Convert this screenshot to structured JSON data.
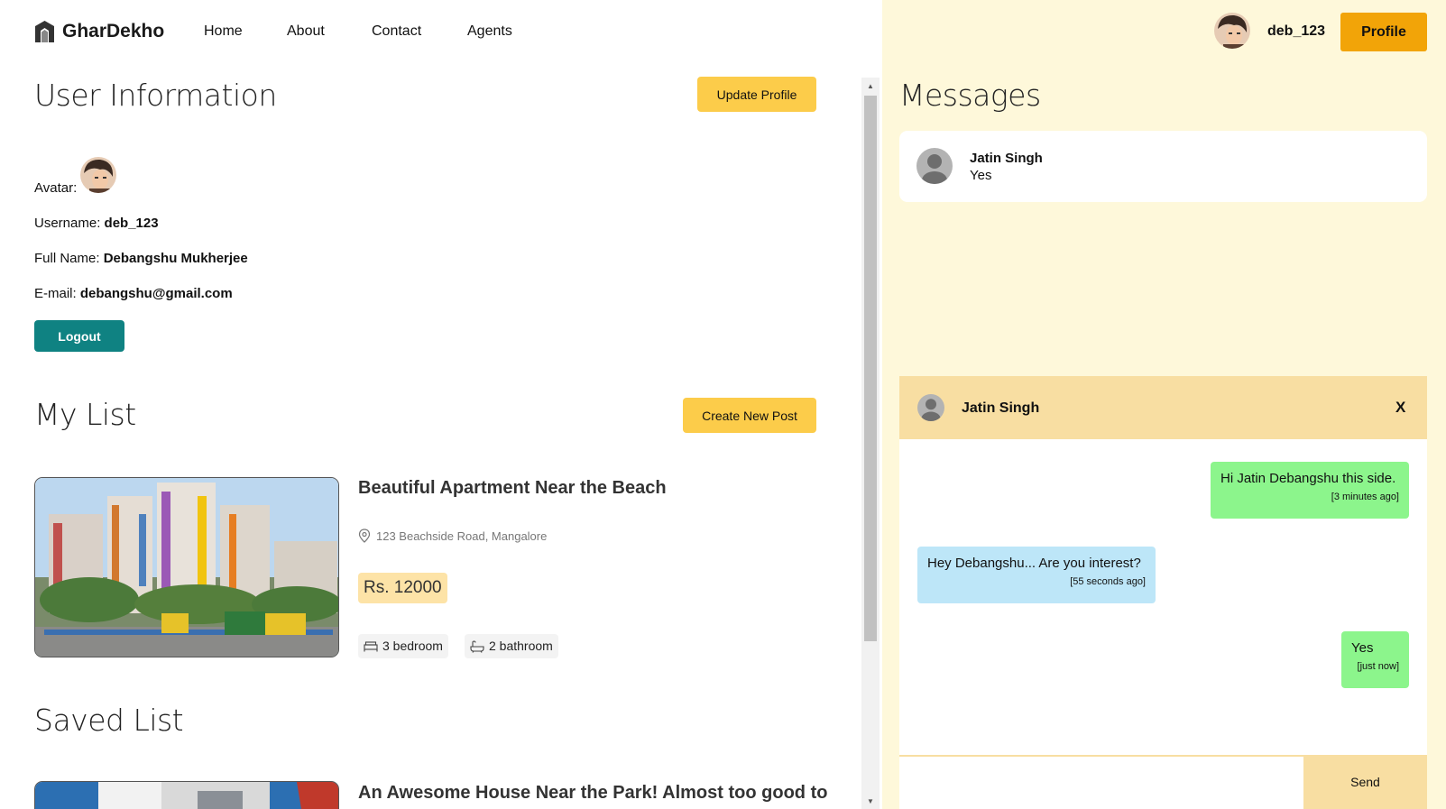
{
  "brand": {
    "name": "GharDekho"
  },
  "nav": {
    "links": [
      "Home",
      "About",
      "Contact",
      "Agents"
    ]
  },
  "header_user": {
    "username": "deb_123",
    "profile_label": "Profile"
  },
  "user_info": {
    "title": "User Information",
    "update_label": "Update Profile",
    "avatar_label": "Avatar:",
    "username_label": "Username:",
    "username": "deb_123",
    "fullname_label": "Full Name:",
    "fullname": "Debangshu Mukherjee",
    "email_label": "E-mail:",
    "email": "debangshu@gmail.com",
    "logout_label": "Logout"
  },
  "my_list": {
    "title": "My List",
    "create_label": "Create New Post",
    "posts": [
      {
        "title": "Beautiful Apartment Near the Beach",
        "address": "123 Beachside Road, Mangalore",
        "price": "Rs. 12000",
        "bedrooms": "3 bedroom",
        "bathrooms": "2 bathroom"
      }
    ]
  },
  "saved_list": {
    "title": "Saved List",
    "posts": [
      {
        "title": "An Awesome House Near the Park! Almost too good to"
      }
    ]
  },
  "messages": {
    "title": "Messages",
    "items": [
      {
        "name": "Jatin Singh",
        "last": "Yes"
      }
    ]
  },
  "chat": {
    "name": "Jatin Singh",
    "close_label": "X",
    "send_label": "Send",
    "messages": [
      {
        "text": "Hi Jatin Debangshu this side.",
        "time": "[3 minutes ago]",
        "own": true
      },
      {
        "text": "Hey Debangshu... Are you interest?",
        "time": "[55 seconds ago]",
        "own": false
      },
      {
        "text": "Yes",
        "time": "[just now]",
        "own": true
      }
    ]
  },
  "colors": {
    "accent": "#f2a408",
    "button_yellow": "#fccc4a",
    "logout_teal": "#0f8282",
    "panel_bg": "#fef8da",
    "chat_header": "#f8dea2",
    "bubble_own": "#8cf58c",
    "bubble_other": "#bde6f8"
  }
}
